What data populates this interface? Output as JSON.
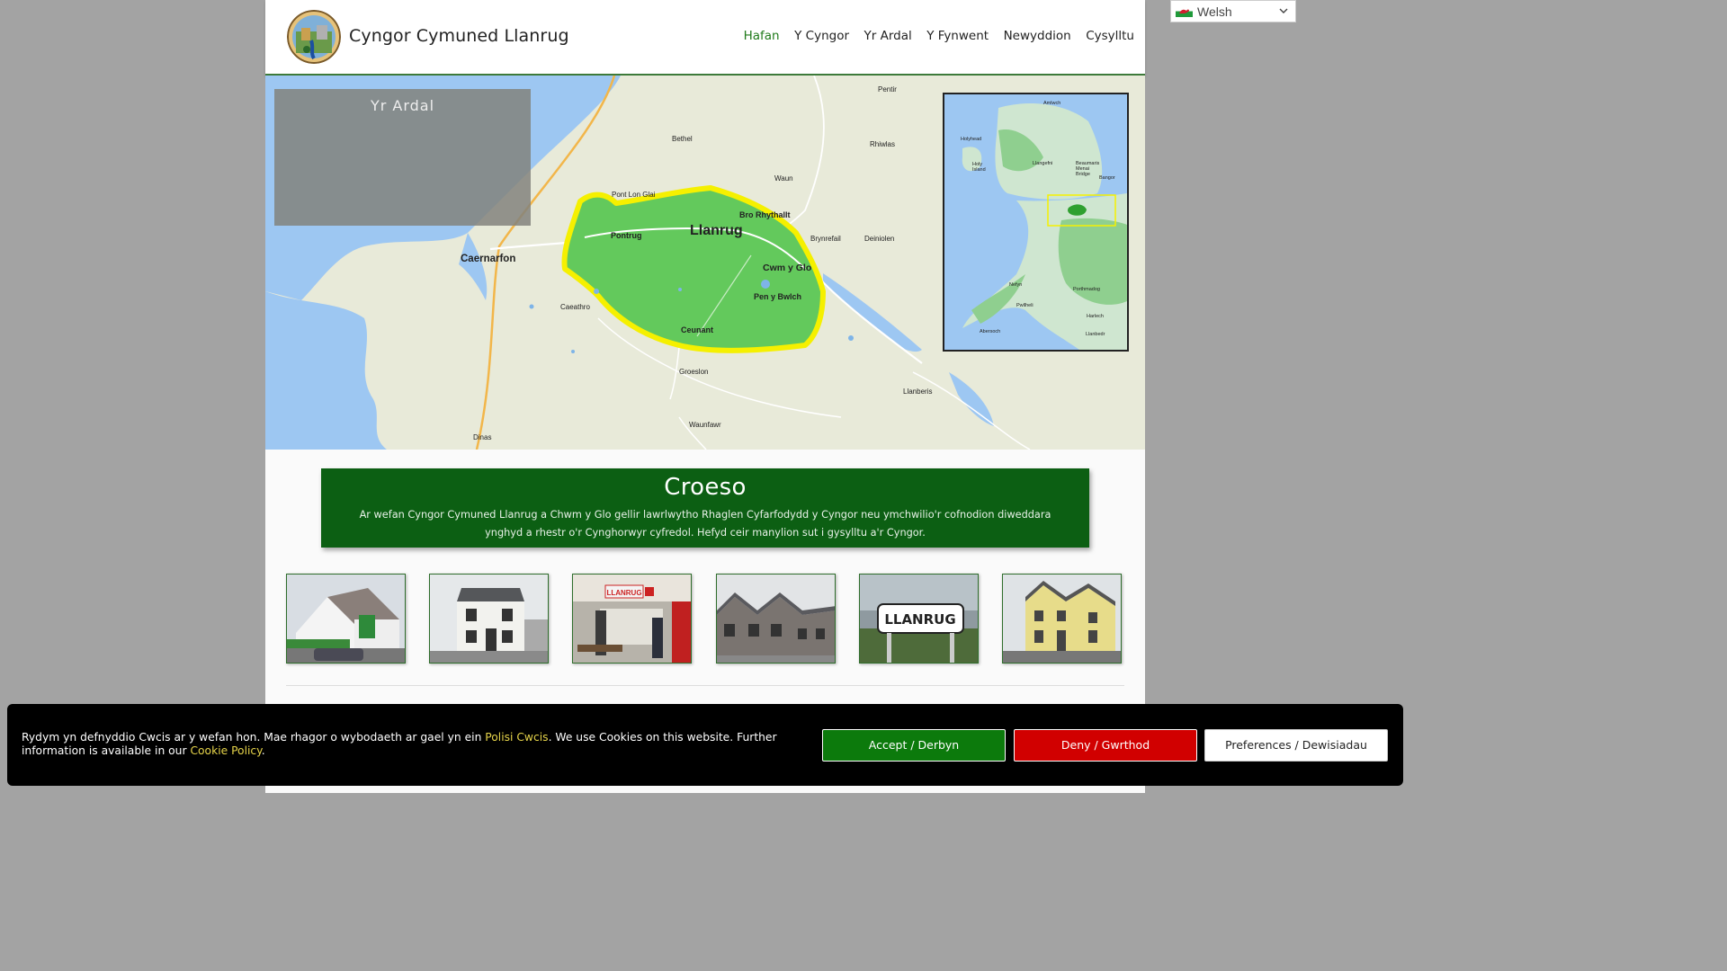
{
  "header": {
    "site_title": "Cyngor Cymuned Llanrug",
    "nav": [
      "Hafan",
      "Y Cyngor",
      "Yr Ardal",
      "Y Fynwent",
      "Newyddion",
      "Cysylltu"
    ],
    "active_nav": "Hafan"
  },
  "language": {
    "selected": "Welsh",
    "icon": "wales-flag-icon"
  },
  "map": {
    "overlay_title": "Yr Ardal",
    "places": {
      "pentir": "Pentir",
      "bethel": "Bethel",
      "rhiwlas": "Rhiwlas",
      "waun": "Waun",
      "pont_lon_glai": "Pont Lon Glai",
      "bro_rhythallt": "Bro Rhythallt",
      "llanrug": "Llanrug",
      "pontrug": "Pontrug",
      "brynrefail": "Brynrefail",
      "deiniolen": "Deiniolen",
      "caernarfon": "Caernarfon",
      "cwm_y_glo": "Cwm y Glo",
      "pen_y_bwlch": "Pen y Bwlch",
      "caeathro": "Caeathro",
      "ceunant": "Ceunant",
      "groeslon": "Groeslon",
      "llanberis": "Llanberis",
      "waunfawr": "Waunfawr",
      "dinas": "Dinas"
    },
    "inset_places": {
      "amlwch": "Amlwch",
      "holyhead": "Holyhead",
      "holy_island": "Holy\nIsland",
      "llangefni": "Llangefni",
      "beaumaris": "Beaumaris",
      "menai_bridge": "Menai\nBridge",
      "bangor": "Bangor",
      "nefyn": "Nefyn",
      "porthmadog": "Porthmadog",
      "pwllheli": "Pwllheli",
      "harlech": "Harlech",
      "abersoch": "Abersoch",
      "llanbedr": "Llanbedr"
    },
    "colors": {
      "sea": "#9dc7f2",
      "land": "#e8ead9",
      "community": "#63c95c",
      "border": "#f5f000",
      "road": "#f2b64a"
    }
  },
  "welcome": {
    "title": "Croeso",
    "text": "Ar wefan Cyngor Cymuned Llanrug a Chwm y Glo gellir lawrlwytho Rhaglen Cyfarfodydd y Cyngor neu ymchwilio'r cofnodion diweddara ynghyd a rhestr o'r Cynghorwyr cyfredol. Hefyd ceir manylion sut i gysylltu a'r Cyngor."
  },
  "gallery": {
    "sign_text": "LLANRUG",
    "shop_sign": "LLANRUG"
  },
  "cookie": {
    "text_before": "Rydym yn defnyddio Cwcis ar y wefan hon. Mae rhagor o wybodaeth ar gael yn ein ",
    "policy_link_1": "Polisi Cwcis",
    "text_middle": ". We use Cookies on this website. Further information is available in our ",
    "policy_link_2": "Cookie Policy",
    "text_after": ".",
    "accept_label": "Accept / Derbyn",
    "deny_label": "Deny / Gwrthod",
    "preferences_label": "Preferences / Dewisiadau"
  }
}
